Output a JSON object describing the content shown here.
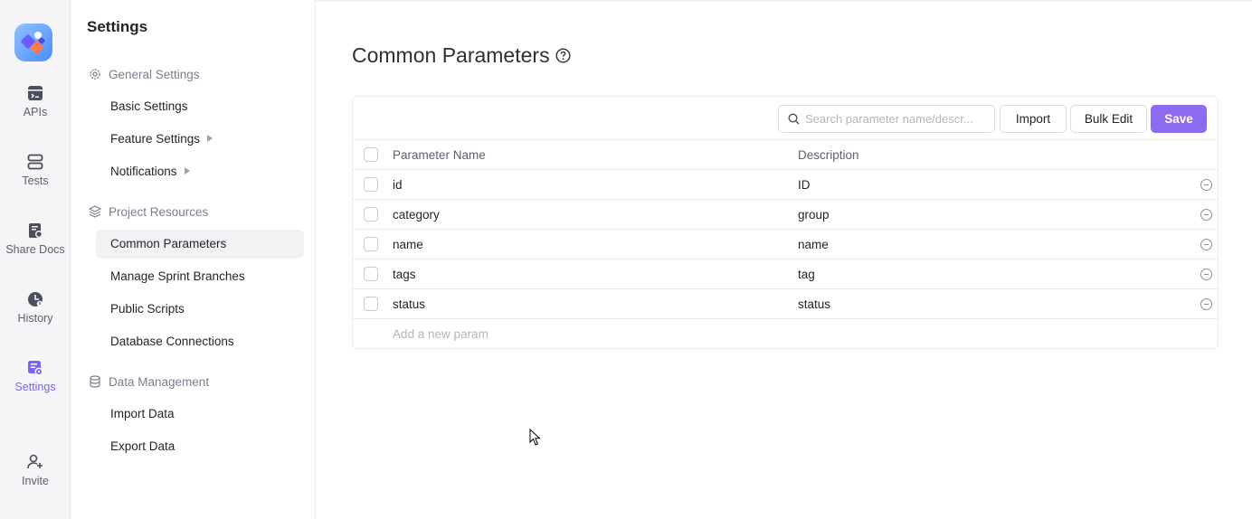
{
  "rail": {
    "items": [
      {
        "label": "APIs",
        "icon": "api-icon"
      },
      {
        "label": "Tests",
        "icon": "tests-icon"
      },
      {
        "label": "Share Docs",
        "icon": "share-docs-icon"
      },
      {
        "label": "History",
        "icon": "history-icon"
      },
      {
        "label": "Settings",
        "icon": "settings-icon",
        "active": true
      },
      {
        "label": "Invite",
        "icon": "invite-icon"
      }
    ],
    "accent": "#7b61ff"
  },
  "sidebar": {
    "title": "Settings",
    "groups": [
      {
        "label": "General Settings",
        "icon": "gear-icon",
        "items": [
          "Basic Settings",
          "Feature Settings",
          "Notifications"
        ]
      },
      {
        "label": "Project Resources",
        "icon": "layers-icon",
        "items": [
          "Common Parameters",
          "Manage Sprint Branches",
          "Public Scripts",
          "Database Connections"
        ]
      },
      {
        "label": "Data Management",
        "icon": "database-icon",
        "items": [
          "Import Data",
          "Export Data"
        ]
      }
    ],
    "active_item": "Common Parameters"
  },
  "main": {
    "title": "Common Parameters",
    "search": {
      "placeholder": "Search parameter name/descr..."
    },
    "buttons": {
      "import": "Import",
      "bulk_edit": "Bulk Edit",
      "save": "Save"
    },
    "columns": {
      "name": "Parameter Name",
      "description": "Description"
    },
    "rows": [
      {
        "name": "id",
        "description": "ID"
      },
      {
        "name": "category",
        "description": "group"
      },
      {
        "name": "name",
        "description": "name"
      },
      {
        "name": "tags",
        "description": "tag"
      },
      {
        "name": "status",
        "description": "status"
      }
    ],
    "add_placeholder": "Add a new param",
    "save_color": "#8b6cf0"
  }
}
